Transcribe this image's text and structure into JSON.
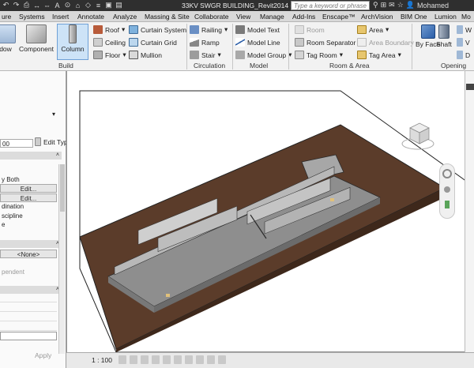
{
  "titlebar": {
    "document_title": "33KV SWGR BUILDING_Revit2014 -",
    "search_placeholder": "Type a keyword or phrase",
    "user": "Mohamed"
  },
  "tabs": [
    "ure",
    "Systems",
    "Insert",
    "Annotate",
    "Analyze",
    "Massing & Site",
    "Collaborate",
    "View",
    "Manage",
    "Add-Ins",
    "Enscape™",
    "ArchVision",
    "BIM One",
    "Lumion",
    "Mo"
  ],
  "ribbon": {
    "build": {
      "label": "Build",
      "window": "dow",
      "component": "Component",
      "column": "Column",
      "roof": "Roof",
      "ceiling": "Ceiling",
      "floor": "Floor",
      "curtain_system": "Curtain System",
      "curtain_grid": "Curtain Grid",
      "mullion": "Mullion"
    },
    "circulation": {
      "label": "Circulation",
      "railing": "Railing",
      "ramp": "Ramp",
      "stair": "Stair"
    },
    "model": {
      "label": "Model",
      "model_text": "Model Text",
      "model_line": "Model Line",
      "model_group": "Model Group"
    },
    "room_area": {
      "label": "Room & Area",
      "room": "Room",
      "room_separator": "Room Separator",
      "tag_room": "Tag Room",
      "area": "Area",
      "area_boundary": "Area Boundary",
      "tag_area": "Tag Area"
    },
    "opening": {
      "label": "Opening",
      "by_face": "By Face",
      "by_face_2": "Face",
      "shaft": "Shaft",
      "w": "W",
      "v": "V",
      "d": "D"
    }
  },
  "properties": {
    "edit_type": "Edit Type",
    "value_00": "00",
    "both": "y Both",
    "edit1": "Edit...",
    "edit2": "Edit...",
    "coordination": "dination",
    "discipline": "scipline",
    "e": "e",
    "none": "<None>",
    "dependent": "pendent",
    "apply": "Apply"
  },
  "status": {
    "scale": "1 : 100"
  },
  "colors": {
    "ground": "#5b3c2a",
    "building": "#9b9b9b",
    "accent_blue": "#1b4d9c"
  }
}
